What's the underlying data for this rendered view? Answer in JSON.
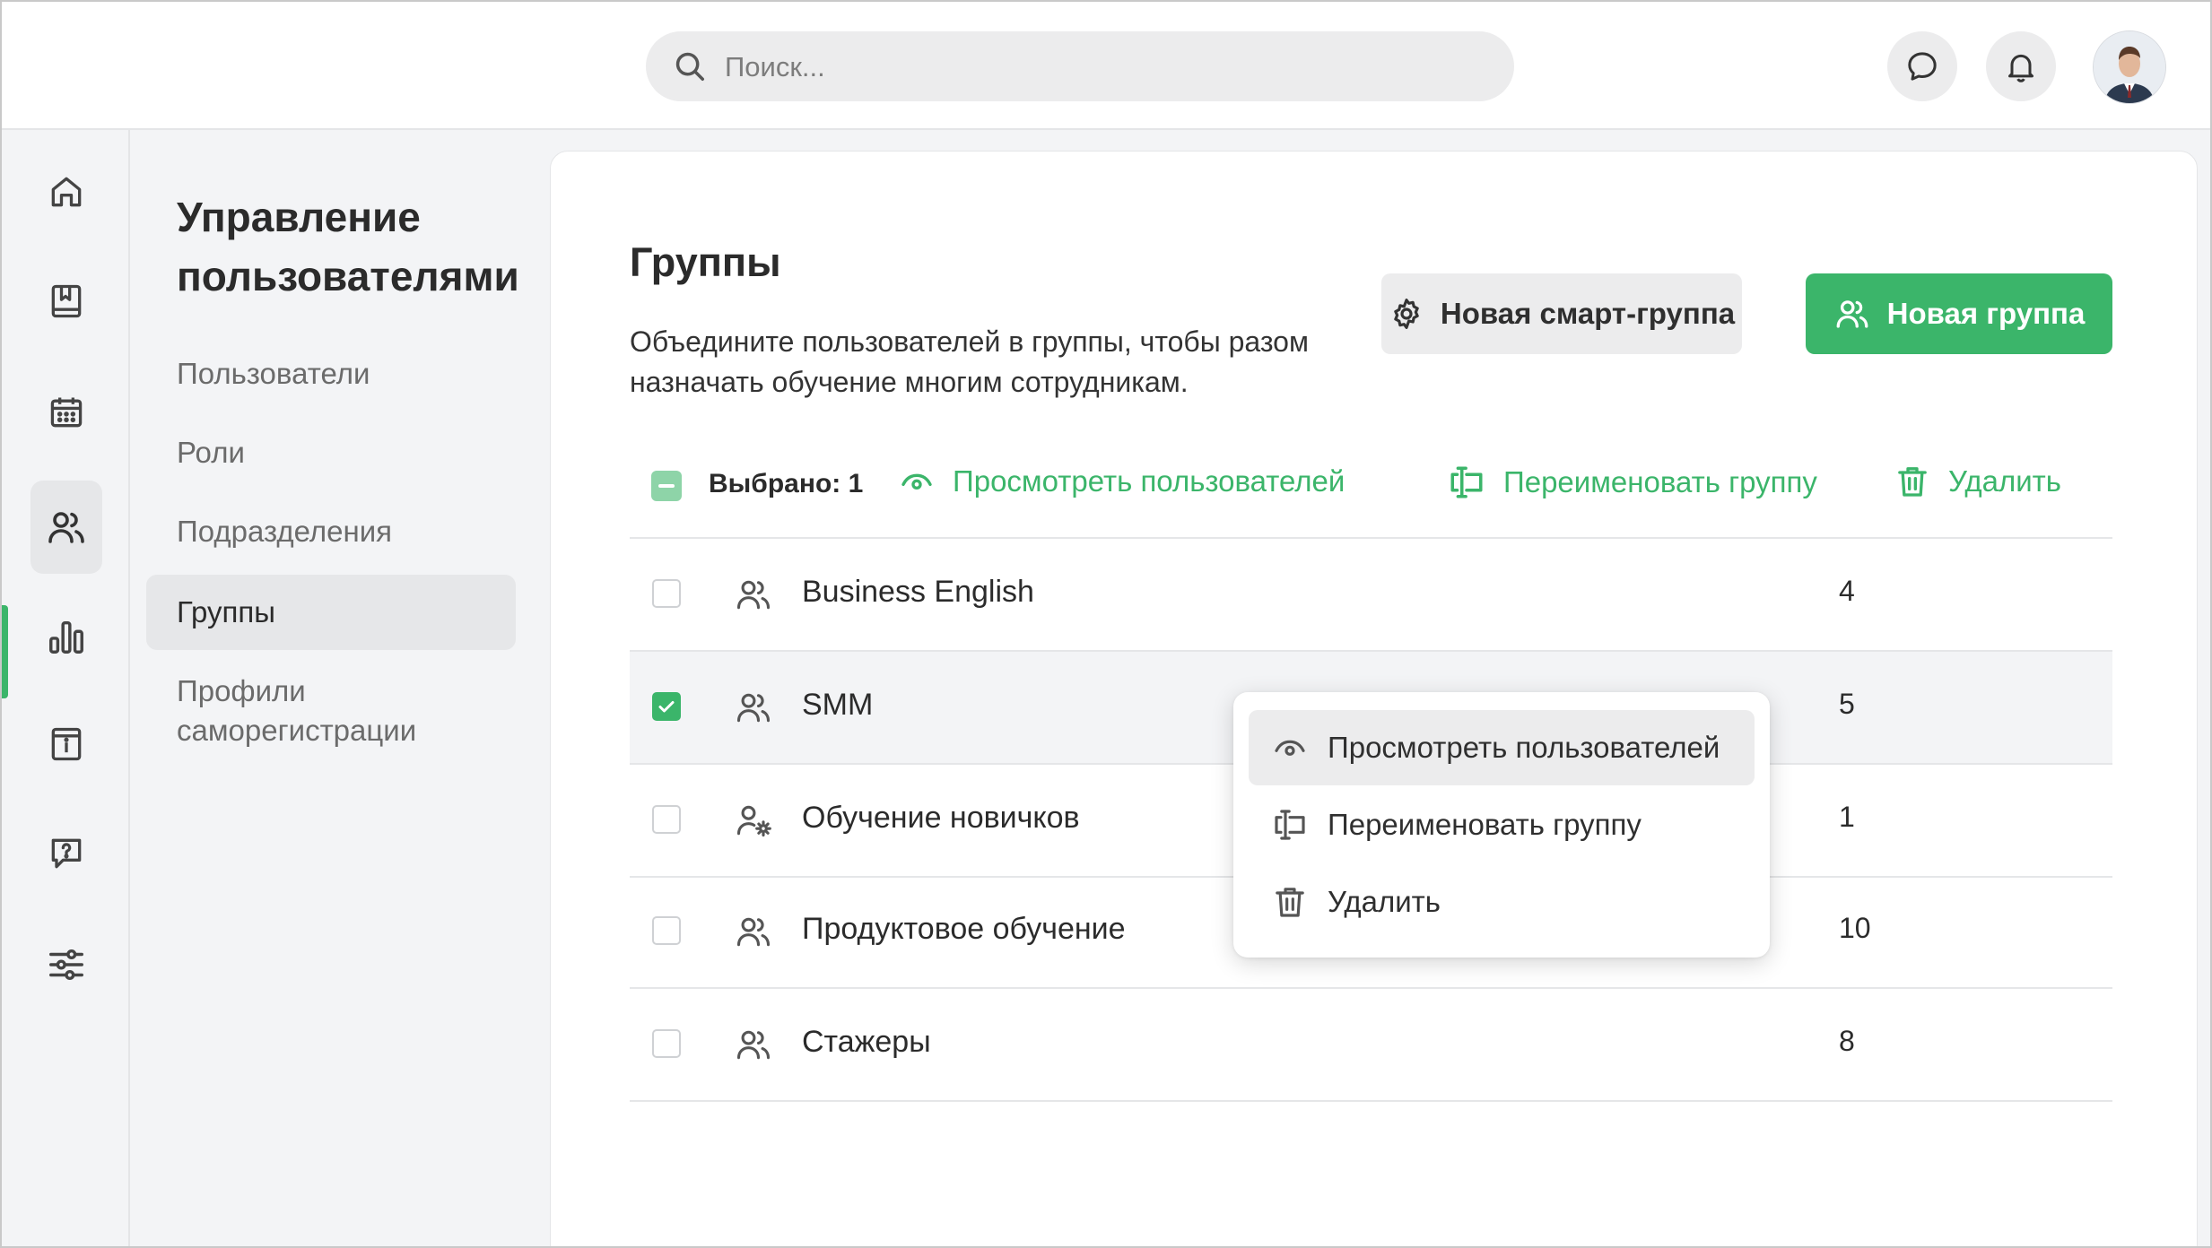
{
  "header": {
    "search_placeholder": "Поиск..."
  },
  "subnav": {
    "title": "Управление пользователями",
    "items": [
      {
        "label": "Пользователи"
      },
      {
        "label": "Роли"
      },
      {
        "label": "Подразделения"
      },
      {
        "label": "Группы",
        "active": true
      },
      {
        "label": "Профили саморегистрации"
      }
    ]
  },
  "main": {
    "title": "Группы",
    "description": "Объедините пользователей в группы, чтобы разом назначать обучение многим сотрудникам.",
    "smart_group_button": "Новая смарт-группа",
    "new_group_button": "Новая группа",
    "bulk": {
      "selected_label": "Выбрано: 1",
      "view_users": "Просмотреть пользователей",
      "rename": "Переименовать группу",
      "delete": "Удалить"
    },
    "groups": [
      {
        "name": "Business English",
        "count": "4",
        "checked": false,
        "icon": "users-icon"
      },
      {
        "name": "SMM",
        "count": "5",
        "checked": true,
        "icon": "users-icon"
      },
      {
        "name": "Обучение новичков",
        "count": "1",
        "checked": false,
        "icon": "smart-group-icon"
      },
      {
        "name": "Продуктовое обучение",
        "count": "10",
        "checked": false,
        "icon": "users-icon"
      },
      {
        "name": "Стажеры",
        "count": "8",
        "checked": false,
        "icon": "users-icon"
      }
    ]
  },
  "context_menu": {
    "view_users": "Просмотреть пользователей",
    "rename": "Переименовать группу",
    "delete": "Удалить"
  },
  "colors": {
    "accent": "#3bb56a",
    "background": "#f3f4f6",
    "card": "#ffffff"
  }
}
